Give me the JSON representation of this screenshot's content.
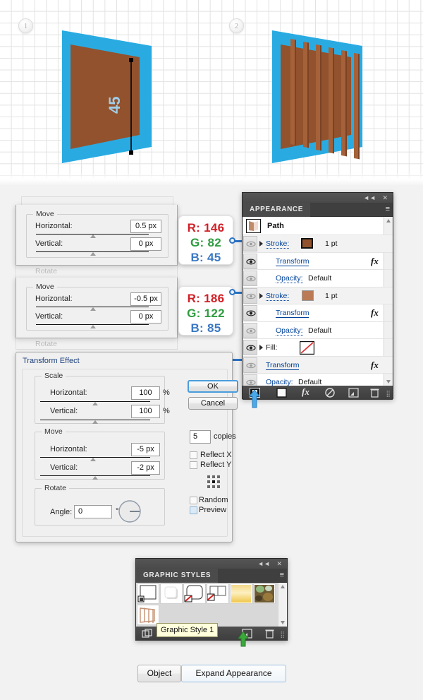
{
  "canvas": {
    "steps": [
      {
        "number": "1",
        "name": "step-1"
      },
      {
        "number": "2",
        "name": "step-2"
      }
    ],
    "artwork": {
      "angle_label": "45",
      "blue": "#29ABE2",
      "brown_dark": "#92522D",
      "brown_light": "#BA7A55"
    }
  },
  "move_dialog_top": {
    "group_label": "Move",
    "horizontal_label": "Horizontal:",
    "horizontal_value": "0.5 px",
    "vertical_label": "Vertical:",
    "vertical_value": "0 px",
    "ghost_label": "Rotate"
  },
  "move_dialog_bottom": {
    "group_label": "Move",
    "horizontal_label": "Horizontal:",
    "horizontal_value": "-0.5 px",
    "vertical_label": "Vertical:",
    "vertical_value": "0 px",
    "ghost_label": "Rotate"
  },
  "callout_top": {
    "r": "R: 146",
    "g": "G: 82",
    "b": "B: 45"
  },
  "callout_bottom": {
    "r": "R: 186",
    "g": "G: 122",
    "b": "B: 85"
  },
  "transform_effect": {
    "title": "Transform Effect",
    "scale": {
      "legend": "Scale",
      "horizontal_label": "Horizontal:",
      "horizontal_value": "100",
      "horizontal_unit": "%",
      "vertical_label": "Vertical:",
      "vertical_value": "100",
      "vertical_unit": "%"
    },
    "move": {
      "legend": "Move",
      "horizontal_label": "Horizontal:",
      "horizontal_value": "-5 px",
      "vertical_label": "Vertical:",
      "vertical_value": "-2 px"
    },
    "rotate": {
      "legend": "Rotate",
      "angle_label": "Angle:",
      "angle_value": "0",
      "degree_symbol": "°"
    },
    "ok_label": "OK",
    "cancel_label": "Cancel",
    "copies_value": "5",
    "copies_label": "copies",
    "reflect_x_label": "Reflect X",
    "reflect_y_label": "Reflect Y",
    "random_label": "Random",
    "preview_label": "Preview"
  },
  "appearance_panel": {
    "tab_label": "APPEARANCE",
    "object_name": "Path",
    "collapse_icon": "◄◄",
    "close_icon": "✕",
    "menu_icon": "≡",
    "rows": [
      {
        "name": "stroke-1",
        "label": "Stroke:",
        "value": "1 pt",
        "swatch": "#92522D",
        "fx": ""
      },
      {
        "name": "transform-1",
        "label": "Transform",
        "value": "",
        "swatch": "",
        "fx": "fx"
      },
      {
        "name": "opacity-1",
        "label": "Opacity:",
        "value": "Default",
        "swatch": "",
        "fx": ""
      },
      {
        "name": "stroke-2",
        "label": "Stroke:",
        "value": "1 pt",
        "swatch": "#BA7A55",
        "fx": ""
      },
      {
        "name": "transform-2",
        "label": "Transform",
        "value": "",
        "swatch": "",
        "fx": "fx"
      },
      {
        "name": "opacity-2",
        "label": "Opacity:",
        "value": "Default",
        "swatch": "",
        "fx": ""
      },
      {
        "name": "fill",
        "label": "Fill:",
        "value": "",
        "swatch": "none",
        "fx": ""
      },
      {
        "name": "transform-3",
        "label": "Transform",
        "value": "",
        "swatch": "",
        "fx": "fx"
      },
      {
        "name": "opacity-3",
        "label": "Opacity:",
        "value": "Default",
        "swatch": "",
        "fx": ""
      }
    ],
    "footer_icons": [
      "add-new-stroke-icon",
      "add-new-fill-icon",
      "add-new-effect-icon",
      "clear-appearance-icon",
      "duplicate-item-icon",
      "delete-item-icon"
    ]
  },
  "graphic_styles_panel": {
    "tab_label": "GRAPHIC STYLES",
    "collapse_icon": "◄◄",
    "close_icon": "✕",
    "menu_icon": "≡",
    "tooltip": "Graphic Style 1",
    "swatches": [
      "default-style",
      "drop-shadow-style",
      "rounded-none-fill-style",
      "split-none-fill-style",
      "yellow-gradient-style",
      "texture-style",
      "fence-style"
    ],
    "footer_icons": [
      "break-link-icon",
      "new-style-icon",
      "delete-style-icon"
    ]
  },
  "bottom_bar": {
    "object_label": "Object",
    "expand_appearance_label": "Expand Appearance"
  }
}
